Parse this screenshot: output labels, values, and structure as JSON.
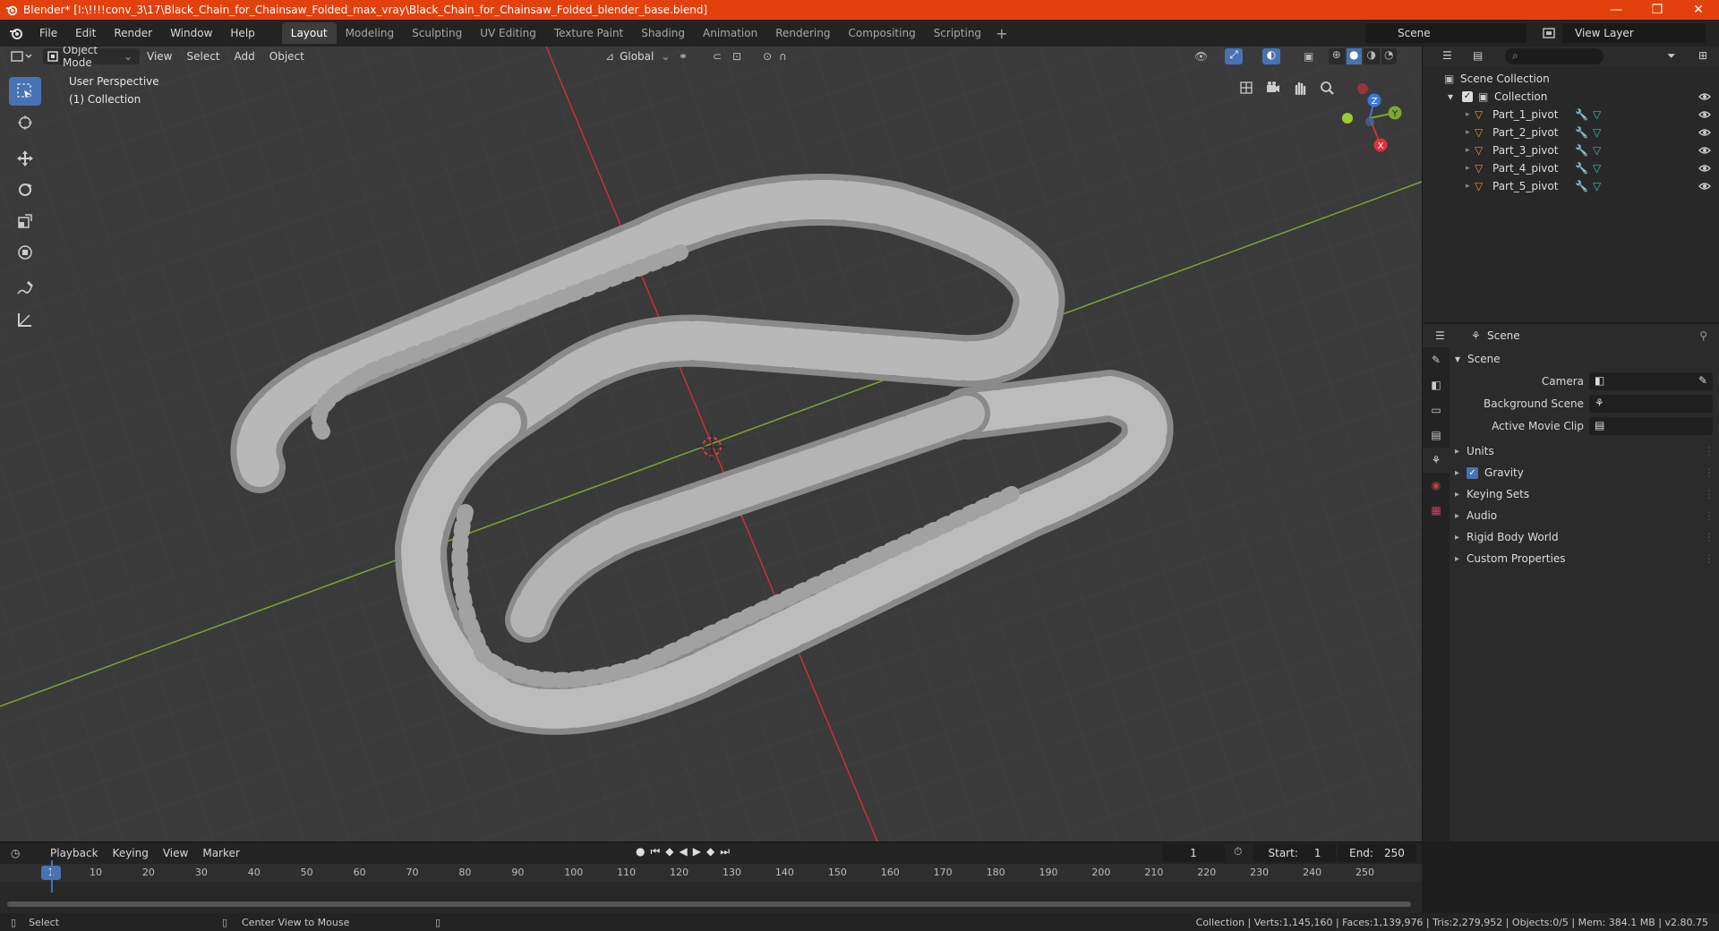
{
  "titlebar": {
    "title": "Blender* [I:\\!!!!conv_3\\17\\Black_Chain_for_Chainsaw_Folded_max_vray\\Black_Chain_for_Chainsaw_Folded_blender_base.blend]",
    "controls": [
      "—",
      "❐",
      "✕"
    ]
  },
  "menubar": {
    "menus": [
      "File",
      "Edit",
      "Render",
      "Window",
      "Help"
    ],
    "workspaces": [
      "Layout",
      "Modeling",
      "Sculpting",
      "UV Editing",
      "Texture Paint",
      "Shading",
      "Animation",
      "Rendering",
      "Compositing",
      "Scripting"
    ],
    "active_workspace": "Layout",
    "scene": "Scene",
    "view_layer": "View Layer"
  },
  "viewport": {
    "mode": "Object Mode",
    "menus": [
      "View",
      "Select",
      "Add",
      "Object"
    ],
    "orientation": "Global",
    "perspective_label": "User Perspective",
    "collection_label": "(1) Collection",
    "gizmo_axes": [
      "X",
      "Y",
      "Z"
    ],
    "colors": {
      "x_axis": "#c8323c",
      "y_axis": "#7da632",
      "z_axis": "#3c78d8",
      "bg": "#3a3a3a",
      "grid": "#444444",
      "chain": "#b4b4b4"
    }
  },
  "outliner": {
    "root": "Scene Collection",
    "collection": "Collection",
    "items": [
      {
        "name": "Part_1_pivot"
      },
      {
        "name": "Part_2_pivot"
      },
      {
        "name": "Part_3_pivot"
      },
      {
        "name": "Part_4_pivot"
      },
      {
        "name": "Part_5_pivot"
      }
    ]
  },
  "properties": {
    "context": "Scene",
    "panel_title": "Scene",
    "fields": [
      {
        "label": "Camera",
        "value": ""
      },
      {
        "label": "Background Scene",
        "value": ""
      },
      {
        "label": "Active Movie Clip",
        "value": ""
      }
    ],
    "sections": [
      "Units",
      "Gravity",
      "Keying Sets",
      "Audio",
      "Rigid Body World",
      "Custom Properties"
    ],
    "gravity_checked": true
  },
  "timeline": {
    "menus": [
      "Playback",
      "Keying",
      "View",
      "Marker"
    ],
    "current_frame": "1",
    "start_label": "Start:",
    "start": "1",
    "end_label": "End:",
    "end": "250",
    "ruler_ticks": [
      "1",
      "10",
      "20",
      "30",
      "40",
      "50",
      "60",
      "70",
      "80",
      "90",
      "100",
      "110",
      "120",
      "130",
      "140",
      "150",
      "160",
      "170",
      "180",
      "190",
      "200",
      "210",
      "220",
      "230",
      "240",
      "250"
    ]
  },
  "statusbar": {
    "left_action": "Select",
    "middle_action": "Center View to Mouse",
    "stats": "Collection | Verts:1,145,160 | Faces:1,139,976 | Tris:2,279,952 | Objects:0/5 | Mem: 384.1 MB | v2.80.75"
  }
}
